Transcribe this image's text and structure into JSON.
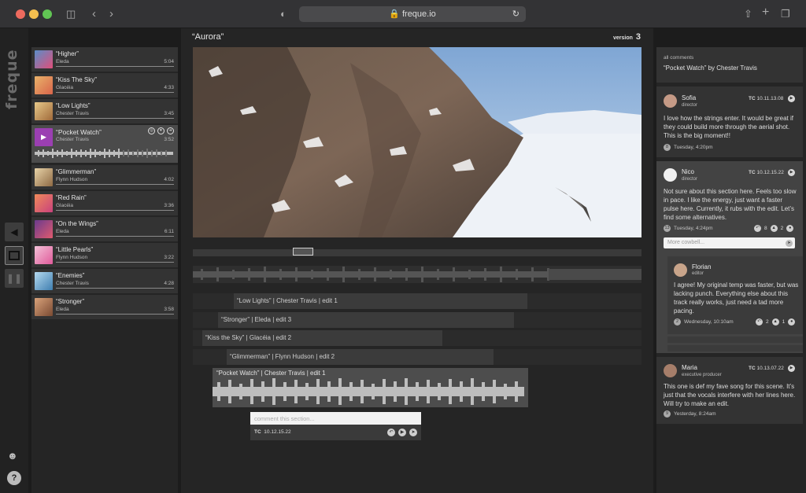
{
  "browser": {
    "url": "freque.io"
  },
  "app": {
    "logo_text": "freque"
  },
  "tracks": [
    {
      "title": "“Higher”",
      "artist": "Eleda",
      "duration": "5:04",
      "thumb": "#5a8dc8"
    },
    {
      "title": "“Kiss The Sky”",
      "artist": "Glacéia",
      "duration": "4:33",
      "thumb": "#d8644a"
    },
    {
      "title": "“Low Lights”",
      "artist": "Chester Travis",
      "duration": "3:45",
      "thumb": "#c08a4c"
    },
    {
      "title": "“Pocket Watch”",
      "artist": "Chester Travis",
      "duration": "3:52",
      "thumb": "#9b3fb2"
    },
    {
      "title": "“Glimmerman”",
      "artist": "Flynn Hudson",
      "duration": "4:02",
      "thumb": "#c9a26b"
    },
    {
      "title": "“Red Rain”",
      "artist": "Glacéia",
      "duration": "3:36",
      "thumb": "#c9427c"
    },
    {
      "title": "“On the Wings”",
      "artist": "Eleda",
      "duration": "6:11",
      "thumb": "#b8386e"
    },
    {
      "title": "“Little Pearls”",
      "artist": "Flynn Hudson",
      "duration": "3:22",
      "thumb": "#e05a9a"
    },
    {
      "title": "“Enemies”",
      "artist": "Chester Travis",
      "duration": "4:28",
      "thumb": "#4f8fbf"
    },
    {
      "title": "“Stronger”",
      "artist": "Eleda",
      "duration": "3:58",
      "thumb": "#b56a4a"
    }
  ],
  "main": {
    "title": "“Aurora”",
    "version_label": "version",
    "version_number": "3"
  },
  "edits": [
    {
      "label": "“Low Lights”  |  Chester Travis  |  edit 1"
    },
    {
      "label": "“Stronger”  |  Eleda  |  edit 3"
    },
    {
      "label": "“Kiss the Sky”  |  Glacéia  |  edit 2"
    },
    {
      "label": "“Glimmerman”  |  Flynn Hudson  |  edit 2"
    },
    {
      "label": "“Pocket Watch”  |  Chester Travis  |  edit 1"
    }
  ],
  "section_comment": {
    "placeholder": "comment this section...",
    "tc_label": "TC",
    "tc": "10.12.15.22"
  },
  "comments_header": {
    "label": "all comments",
    "subject": "“Pocket Watch” by Chester Travis"
  },
  "comments": [
    {
      "name": "Sofia",
      "role": "director",
      "tc_label": "TC",
      "tc": "10.11.13.08",
      "body": "I love how the strings enter. It would be great if they could build more through the aerial shot. This is the big moment!!",
      "count": "8",
      "time": "Tuesday, 4:20pm"
    },
    {
      "name": "Nico",
      "role": "director",
      "tc_label": "TC",
      "tc": "10.12.15.22",
      "body": "Not sure about this section here. Feels too slow in pace. I like the energy, just want a faster pulse here. Currently, it rubs with the edit. Let’s find some alternatives.",
      "count": "13",
      "time": "Tuesday, 4:24pm",
      "likes": "8",
      "replies": "2",
      "reply_placeholder": "More cowbell..."
    },
    {
      "name": "Florian",
      "role": "editor",
      "body": "I agree! My original temp was faster, but was lacking punch. Everything else about this track really works, just need a tad more pacing.",
      "count": "2",
      "time": "Wednesday, 10:10am",
      "likes": "2",
      "replies": "1"
    },
    {
      "name": "Maria",
      "role": "executive producer",
      "tc_label": "TC",
      "tc": "10.13.07.22",
      "body": "This one is def my fave song for this scene. It’s just that the vocals interfere with her lines here. Will try to make an edit.",
      "count": "9",
      "time": "Yesterday, 8:24am"
    }
  ]
}
